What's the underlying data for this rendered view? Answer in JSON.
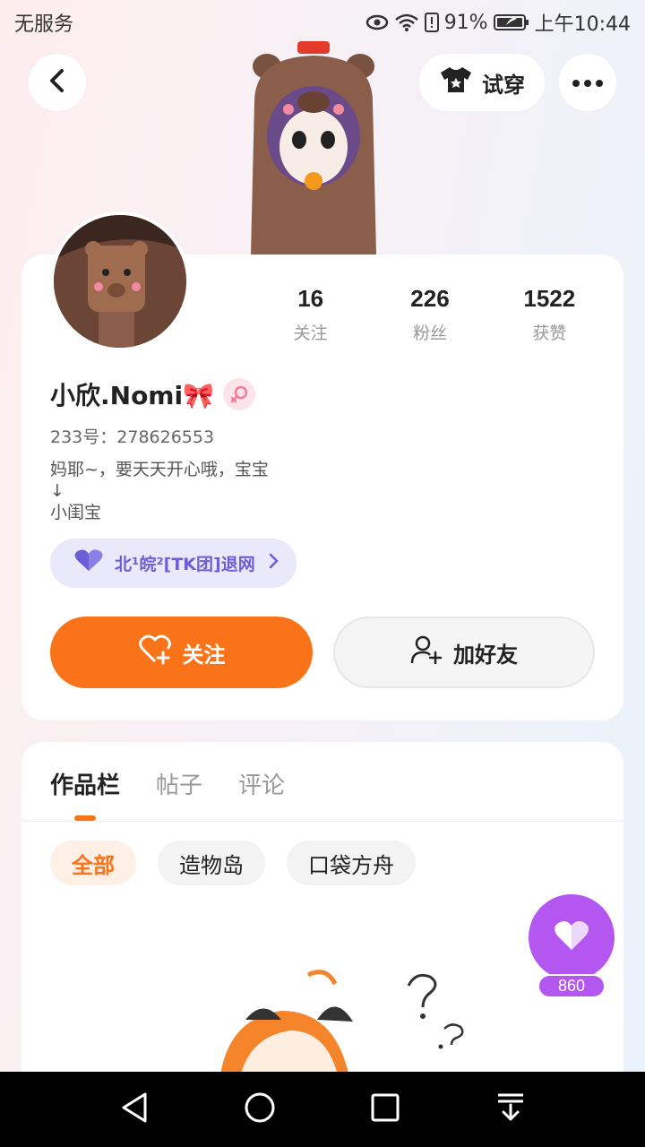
{
  "status_bar": {
    "carrier": "无服务",
    "battery": "91%",
    "time": "上午10:44"
  },
  "header": {
    "try_on_label": "试穿"
  },
  "profile": {
    "stats": [
      {
        "value": "16",
        "label": "关注"
      },
      {
        "value": "226",
        "label": "粉丝"
      },
      {
        "value": "1522",
        "label": "获赞"
      }
    ],
    "username": "小欣.Nomi🎀",
    "uid": "233号：278626553",
    "bio_line1": "妈耶~，要天天开心哦，宝宝",
    "bio_line2": "↓",
    "bio_line3": "小闺宝",
    "group_label": "北¹皖²[TK团]退网",
    "follow_label": "关注",
    "add_friend_label": "加好友"
  },
  "works": {
    "tabs": [
      "作品栏",
      "帖子",
      "评论"
    ],
    "active_tab": 0,
    "chips": [
      "全部",
      "造物岛",
      "口袋方舟"
    ],
    "active_chip": 0
  },
  "like_fab": {
    "count": "860"
  },
  "colors": {
    "accent": "#fb7319",
    "like": "#b457f0",
    "group": "#6c5fd6"
  }
}
